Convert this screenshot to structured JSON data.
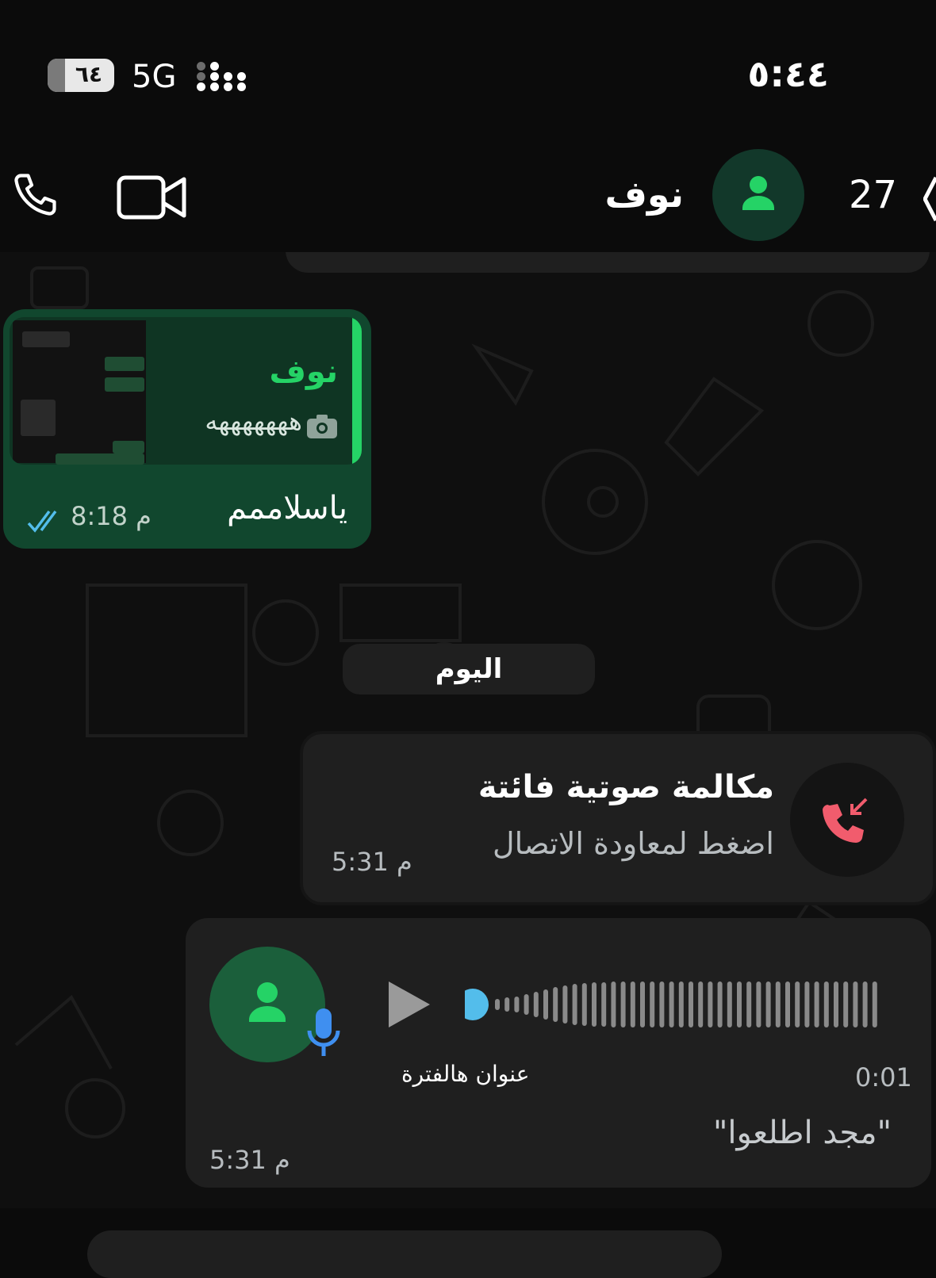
{
  "status_bar": {
    "time": "٥:٤٤",
    "battery": "٦٤",
    "network": "5G"
  },
  "header": {
    "contact_name": "نوف",
    "unread_count": "27"
  },
  "messages": {
    "reply": {
      "quoted_author": "نوف",
      "quoted_text": "هههههههه",
      "text": "ياسلاممم",
      "time": "8:18 م"
    },
    "date_divider": "اليوم",
    "missed_call": {
      "title": "مكالمة صوتية فائتة",
      "subtitle": "اضغط لمعاودة الاتصال",
      "time": "5:31 م"
    },
    "voice_note": {
      "duration": "0:01",
      "overlay_text": "عنوان هالفترة",
      "transcript": "\"مجد اطلعوا\"",
      "time": "5:31 م"
    }
  },
  "colors": {
    "accent_green": "#25d366",
    "outgoing_bubble": "#11472e",
    "incoming_bubble": "#1f1f1f",
    "missed_red": "#f15c6d",
    "play_dot": "#53bdeb",
    "read_tick": "#53bdeb"
  },
  "icons": {
    "call": "phone-icon",
    "video": "video-icon",
    "back": "back-chevron-icon",
    "camera": "camera-icon",
    "missed_call": "missed-call-icon",
    "play": "play-icon",
    "mic": "mic-icon"
  }
}
